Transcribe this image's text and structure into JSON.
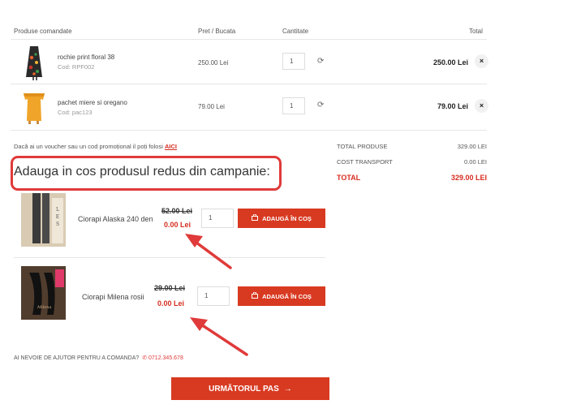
{
  "cart": {
    "headers": {
      "product": "Produse comandate",
      "price": "Pret / Bucata",
      "quantity": "Cantitate",
      "total": "Total"
    },
    "items": [
      {
        "name": "rochie print floral 38",
        "code": "Cod: RPF002",
        "price": "250.00 Lei",
        "quantity": "1",
        "total": "250.00 Lei",
        "refresh_icon": "refresh-icon",
        "remove_icon": "close-icon"
      },
      {
        "name": "pachet miere si oregano",
        "code": "Cod: pac123",
        "price": "79.00 Lei",
        "quantity": "1",
        "total": "79.00 Lei",
        "refresh_icon": "refresh-icon",
        "remove_icon": "close-icon"
      }
    ]
  },
  "voucher": {
    "text": "Dacă ai un voucher sau un cod promoțional il poți folosi",
    "link": "AICI"
  },
  "summary": {
    "products_label": "TOTAL PRODUSE",
    "products_value": "329.00 LEI",
    "transport_label": "COST TRANSPORT",
    "transport_value": "0.00 LEI",
    "total_label": "TOTAL",
    "total_value": "329.00 LEI"
  },
  "campaign": {
    "title": "Adauga in cos produsul redus din campanie:",
    "products": [
      {
        "name": "Ciorapi Alaska 240 den",
        "old_price": "52.00 Lei",
        "new_price": "0.00 Lei",
        "quantity": "1",
        "button": "ADAUGĂ ÎN COȘ"
      },
      {
        "name": "Ciorapi Milena rosii",
        "old_price": "29.00 Lei",
        "new_price": "0.00 Lei",
        "quantity": "1",
        "button": "ADAUGĂ ÎN COȘ"
      }
    ]
  },
  "help": {
    "text": "AI NEVOIE DE AJUTOR PENTRU A COMANDA?",
    "phone": "0712.345.678"
  },
  "next_button": {
    "label": "URMĂTORUL PAS",
    "arrow": "→"
  },
  "colors": {
    "accent": "#d83a21",
    "annotation": "#e03a3a"
  }
}
